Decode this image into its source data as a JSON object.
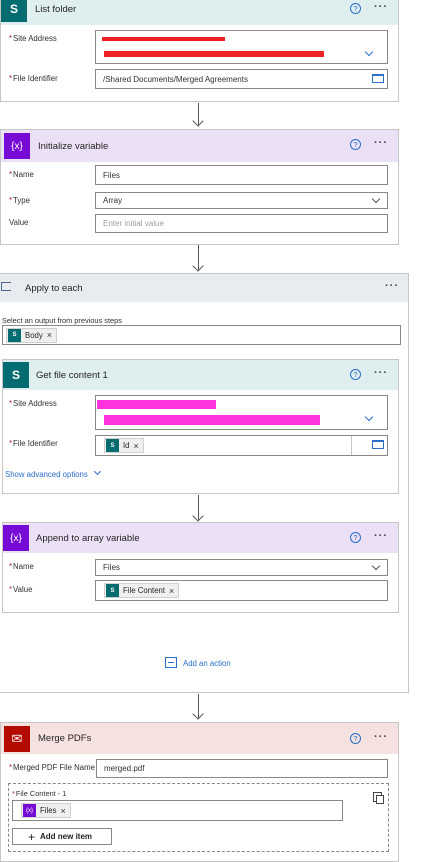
{
  "list_folder": {
    "title": "List folder",
    "site_address_label": "Site Address",
    "file_identifier_label": "File Identifier",
    "file_identifier_value": "/Shared Documents/Merged Agreements"
  },
  "init_variable": {
    "title": "Initialize variable",
    "name_label": "Name",
    "name_value": "Files",
    "type_label": "Type",
    "type_value": "Array",
    "value_label": "Value",
    "value_placeholder": "Enter initial value"
  },
  "apply_each": {
    "title": "Apply to each",
    "select_label": "Select an output from previous steps",
    "token": "Body"
  },
  "get_file": {
    "title": "Get file content 1",
    "site_address_label": "Site Address",
    "file_identifier_label": "File Identifier",
    "file_identifier_token": "Id",
    "advanced_label": "Show advanced options"
  },
  "append": {
    "title": "Append to array variable",
    "name_label": "Name",
    "name_value": "Files",
    "value_label": "Value",
    "value_token": "File Content"
  },
  "add_action": {
    "label": "Add an action"
  },
  "merge": {
    "title": "Merge PDFs",
    "file_name_label": "Merged PDF File Name",
    "file_name_value": "merged.pdf",
    "file_content_label": "File Content - 1",
    "file_content_token": "Files",
    "add_item_label": "Add new item"
  },
  "common": {
    "help_glyph": "?",
    "more_glyph": "···",
    "remove_glyph": "×",
    "required_mark": "*"
  },
  "colors": {
    "sharepoint": "#036c70",
    "variable": "#770bd6",
    "apply_each": "#486991",
    "acrobat": "#b30b00",
    "variable_header": "#ece0f7",
    "sharepoint_header": "#dfeeee",
    "apply_header": "#e8ecf1",
    "acrobat_header": "#f4e1e0",
    "link": "#2b6fca"
  },
  "icons": [
    "sharepoint-icon",
    "variable-icon",
    "loop-icon",
    "acrobat-icon",
    "help-icon",
    "more-icon",
    "chevron-down-icon",
    "folder-icon",
    "add-action-icon",
    "copy-icon",
    "plus-icon"
  ]
}
